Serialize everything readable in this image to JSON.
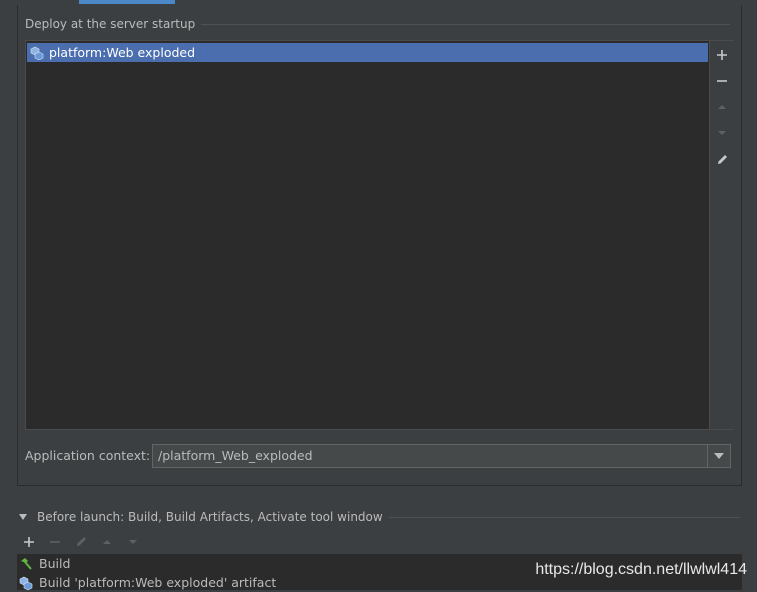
{
  "deploy": {
    "title": "Deploy at the server startup",
    "items": [
      {
        "label": "platform:Web exploded",
        "icon": "artifact-icon",
        "selected": true
      }
    ],
    "toolbar": [
      "add-icon",
      "remove-icon",
      "move-up-icon",
      "move-down-icon",
      "edit-icon"
    ]
  },
  "context": {
    "label": "Application context:",
    "value": "/platform_Web_exploded"
  },
  "before_launch": {
    "title": "Before launch: Build, Build Artifacts, Activate tool window",
    "tasks": [
      {
        "label": "Build",
        "icon": "hammer-icon"
      },
      {
        "label": "Build 'platform:Web exploded' artifact",
        "icon": "artifact-icon"
      }
    ]
  },
  "watermark": "https://blog.csdn.net/llwlwl414",
  "colors": {
    "selection": "#4b6eaf",
    "background": "#3c3f41",
    "list_bg": "#2b2b2b",
    "accent": "#4a88c7"
  }
}
